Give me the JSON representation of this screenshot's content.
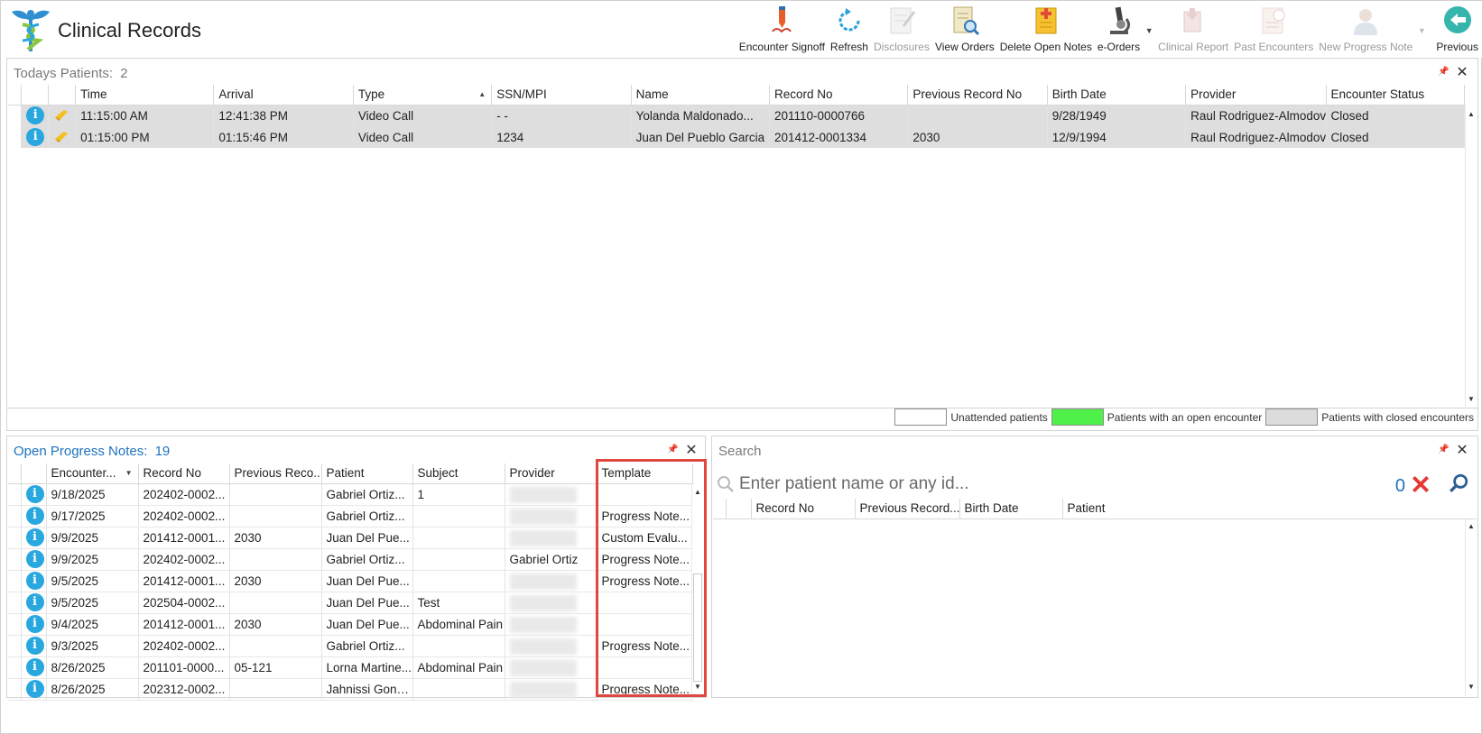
{
  "app": {
    "title": "Clinical Records"
  },
  "toolbar": {
    "encounter_signoff": "Encounter Signoff",
    "refresh": "Refresh",
    "disclosures": "Disclosures",
    "view_orders": "View Orders",
    "delete_open_notes": "Delete Open Notes",
    "e_orders": "e-Orders",
    "clinical_report": "Clinical Report",
    "past_encounters": "Past Encounters",
    "new_progress_note": "New Progress Note",
    "previous": "Previous"
  },
  "todays_patients": {
    "title": "Todays Patients:",
    "count": "2",
    "columns": [
      "Time",
      "Arrival",
      "Type",
      "SSN/MPI",
      "Name",
      "Record No",
      "Previous Record No",
      "Birth Date",
      "Provider",
      "Encounter Status"
    ],
    "rows": [
      {
        "time": "11:15:00 AM",
        "arrival": "12:41:38 PM",
        "type": "Video Call",
        "ssn": "-  -",
        "name": "Yolanda Maldonado...",
        "record_no": "201110-0000766",
        "prev_record": "",
        "birth_date": "9/28/1949",
        "provider": "Raul Rodriguez-Almodov",
        "status": "Closed"
      },
      {
        "time": "01:15:00 PM",
        "arrival": "01:15:46 PM",
        "type": "Video Call",
        "ssn": "1234",
        "name": "Juan Del Pueblo Garcia",
        "record_no": "201412-0001334",
        "prev_record": "2030",
        "birth_date": "12/9/1994",
        "provider": "Raul Rodriguez-Almodov",
        "status": "Closed"
      }
    ]
  },
  "legend": {
    "unattended": "Unattended patients",
    "open": "Patients with an open encounter",
    "closed": "Patients with closed encounters",
    "colors": {
      "unattended": "#ffffff",
      "open": "#4ff04a",
      "closed": "#dcdcdc"
    }
  },
  "open_notes": {
    "title": "Open Progress Notes:",
    "count": "19",
    "columns": [
      "Encounter...",
      "Record No",
      "Previous Reco...",
      "Patient",
      "Subject",
      "Provider",
      "Template"
    ],
    "rows": [
      {
        "date": "9/18/2025",
        "record": "202402-0002...",
        "prev": "",
        "patient": "Gabriel Ortiz...",
        "subject": "1",
        "provider": "",
        "template": ""
      },
      {
        "date": "9/17/2025",
        "record": "202402-0002...",
        "prev": "",
        "patient": "Gabriel Ortiz...",
        "subject": "",
        "provider": "",
        "template": "Progress Note..."
      },
      {
        "date": "9/9/2025",
        "record": "201412-0001...",
        "prev": "2030",
        "patient": "Juan Del Pue...",
        "subject": "",
        "provider": "",
        "template": "Custom Evalu..."
      },
      {
        "date": "9/9/2025",
        "record": "202402-0002...",
        "prev": "",
        "patient": "Gabriel Ortiz...",
        "subject": "",
        "provider": "Gabriel Ortiz",
        "template": "Progress Note..."
      },
      {
        "date": "9/5/2025",
        "record": "201412-0001...",
        "prev": "2030",
        "patient": "Juan Del Pue...",
        "subject": "",
        "provider": "",
        "template": "Progress Note..."
      },
      {
        "date": "9/5/2025",
        "record": "202504-0002...",
        "prev": "",
        "patient": "Juan Del Pue...",
        "subject": "Test",
        "provider": "",
        "template": ""
      },
      {
        "date": "9/4/2025",
        "record": "201412-0001...",
        "prev": "2030",
        "patient": "Juan Del Pue...",
        "subject": "Abdominal Pain",
        "provider": "",
        "template": ""
      },
      {
        "date": "9/3/2025",
        "record": "202402-0002...",
        "prev": "",
        "patient": "Gabriel Ortiz...",
        "subject": "",
        "provider": "",
        "template": "Progress Note..."
      },
      {
        "date": "8/26/2025",
        "record": "201101-0000...",
        "prev": "05-121",
        "patient": "Lorna Martine...",
        "subject": "Abdominal Pain",
        "provider": "",
        "template": ""
      },
      {
        "date": "8/26/2025",
        "record": "202312-0002...",
        "prev": "",
        "patient": "Jahnissi Gonz...",
        "subject": "",
        "provider": "",
        "template": "Progress Note..."
      }
    ]
  },
  "search": {
    "title": "Search",
    "placeholder": "Enter patient name or any id...",
    "count": "0",
    "columns": [
      "Record No",
      "Previous Record...",
      "Birth Date",
      "Patient"
    ]
  }
}
